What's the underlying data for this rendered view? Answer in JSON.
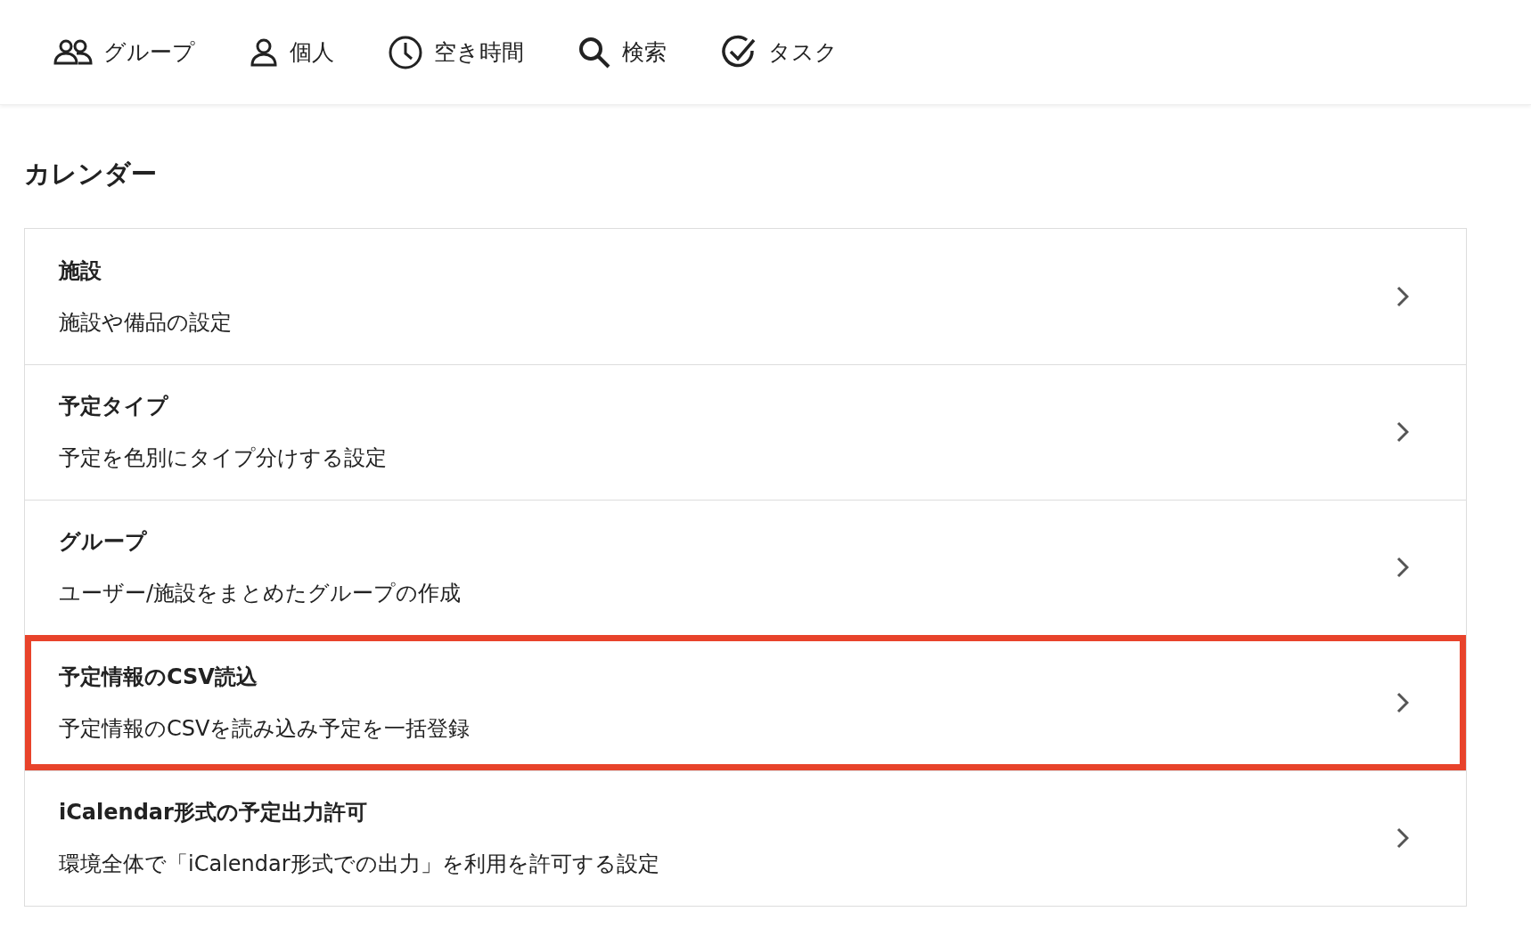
{
  "nav": [
    {
      "kind": "group",
      "label": "グループ"
    },
    {
      "kind": "person",
      "label": "個人"
    },
    {
      "kind": "clock",
      "label": "空き時間"
    },
    {
      "kind": "search",
      "label": "検索"
    },
    {
      "kind": "task",
      "label": "タスク"
    }
  ],
  "section_title": "カレンダー",
  "items": [
    {
      "title": "施設",
      "description": "施設や備品の設定",
      "highlighted": false
    },
    {
      "title": "予定タイプ",
      "description": "予定を色別にタイプ分けする設定",
      "highlighted": false
    },
    {
      "title": "グループ",
      "description": "ユーザー/施設をまとめたグループの作成",
      "highlighted": false
    },
    {
      "title": "予定情報のCSV読込",
      "description": "予定情報のCSVを読み込み予定を一括登録",
      "highlighted": true
    },
    {
      "title": "iCalendar形式の予定出力許可",
      "description": "環境全体で「iCalendar形式での出力」を利用を許可する設定",
      "highlighted": false
    }
  ]
}
